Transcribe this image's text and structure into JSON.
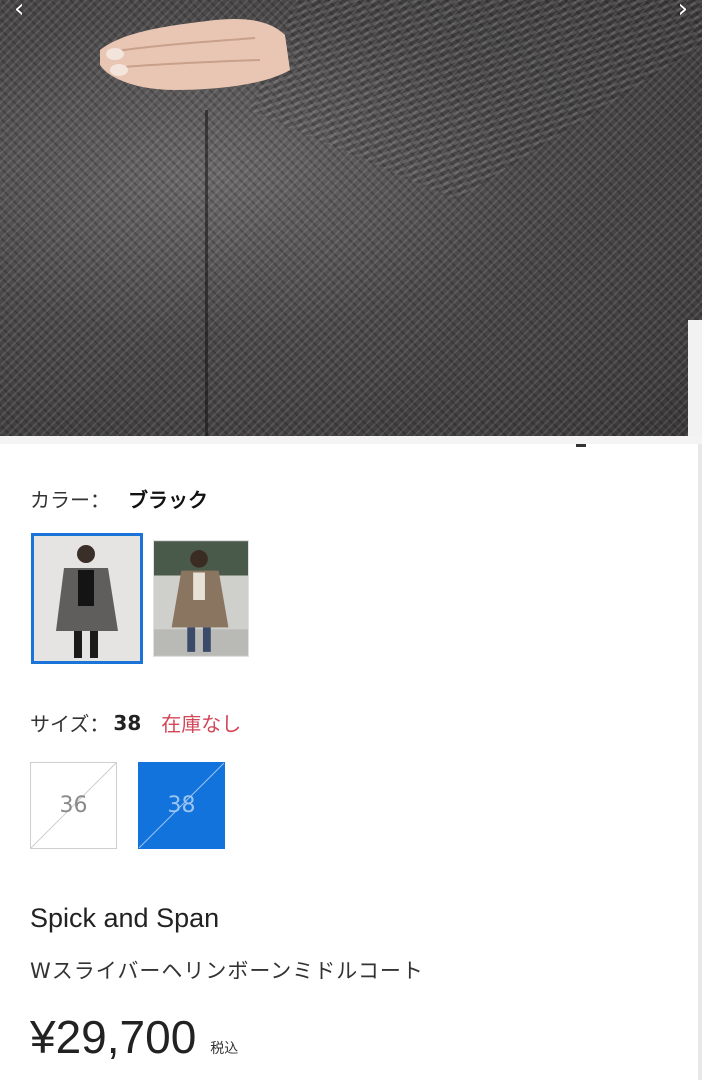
{
  "hero": {
    "prev_icon": "chevron-left-icon",
    "next_icon": "chevron-right-icon",
    "prev_glyph": "‹",
    "next_glyph": "›"
  },
  "color": {
    "label": "カラー：",
    "value": "ブラック",
    "swatches": [
      {
        "name": "black-coat",
        "selected": true
      },
      {
        "name": "brown-coat",
        "selected": false
      }
    ]
  },
  "size": {
    "label": "サイズ：",
    "value": "38",
    "stock_status": "在庫なし",
    "options": [
      {
        "label": "36",
        "selected": false,
        "sold_out": true
      },
      {
        "label": "38",
        "selected": true,
        "sold_out": true
      }
    ]
  },
  "product": {
    "brand": "Spick and Span",
    "name": "Wスライバーヘリンボーンミドルコート",
    "price": "¥29,700",
    "tax_note": "税込"
  },
  "colors": {
    "accent": "#1273dc",
    "stock_warning": "#d24657"
  }
}
